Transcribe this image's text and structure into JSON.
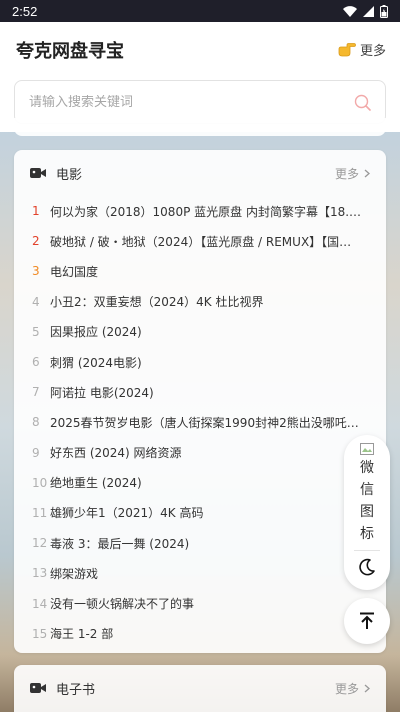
{
  "status": {
    "time": "2:52"
  },
  "app": {
    "title": "夸克网盘寻宝",
    "more_label": "更多"
  },
  "search": {
    "placeholder": "请输入搜索关键词"
  },
  "movie": {
    "title": "电影",
    "more_label": "更多",
    "items": [
      {
        "rank": "1",
        "label": "何以为家（2018）1080P 蓝光原盘 内封简繁字幕【18.…"
      },
      {
        "rank": "2",
        "label": "破地狱 / 破・地狱（2024）【蓝光原盘 / REMUX】【国…"
      },
      {
        "rank": "3",
        "label": "电幻国度"
      },
      {
        "rank": "4",
        "label": "小丑2：双重妄想（2024）4K 杜比视界"
      },
      {
        "rank": "5",
        "label": "因果报应 (2024)"
      },
      {
        "rank": "6",
        "label": "刺猬 (2024电影)"
      },
      {
        "rank": "7",
        "label": "阿诺拉 电影(2024)"
      },
      {
        "rank": "8",
        "label": "2025春节贺岁电影（唐人街探案1990封神2熊出没哪吒…"
      },
      {
        "rank": "9",
        "label": "好东西 (2024) 网络资源"
      },
      {
        "rank": "10",
        "label": "绝地重生 (2024)"
      },
      {
        "rank": "11",
        "label": "雄狮少年1（2021）4K 高码"
      },
      {
        "rank": "12",
        "label": "毒液 3：最后一舞 (2024)"
      },
      {
        "rank": "13",
        "label": "绑架游戏"
      },
      {
        "rank": "14",
        "label": "没有一顿火锅解决不了的事"
      },
      {
        "rank": "15",
        "label": "海王 1-2 部"
      }
    ]
  },
  "ebook": {
    "title": "电子书",
    "more_label": "更多"
  },
  "float": {
    "wechat_alt": "微信图标"
  },
  "colors": {
    "rank_hot": "#e2412a",
    "rank_third": "#f08a24",
    "header_bg": "#ffffff"
  }
}
